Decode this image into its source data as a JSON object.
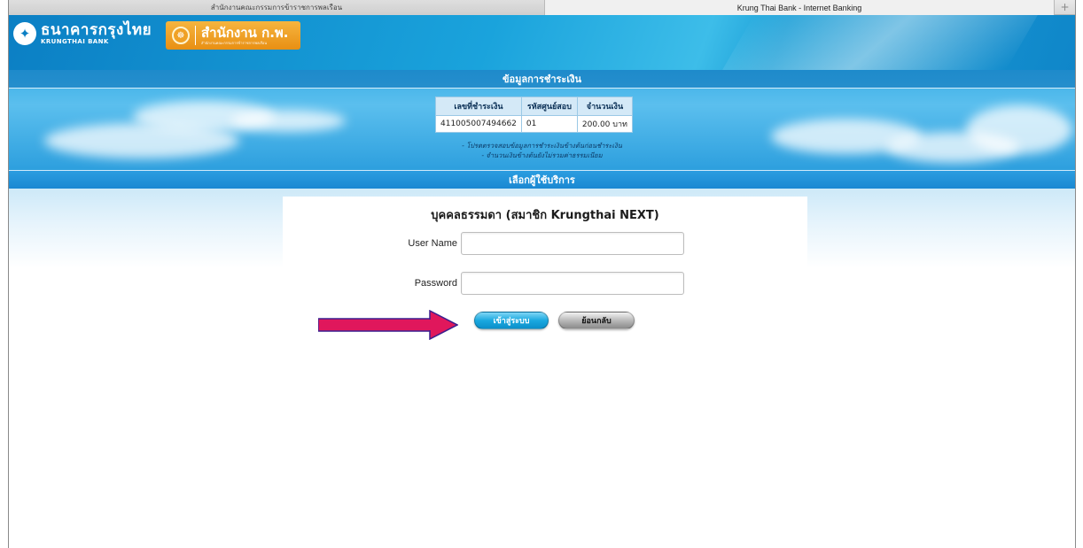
{
  "browser": {
    "tab_inactive": "สำนักงานคณะกรรมการข้าราชการพลเรือน",
    "tab_active": "Krung Thai Bank - Internet Banking",
    "new_tab_glyph": "+"
  },
  "header": {
    "bank_name_th": "ธนาคารกรุงไทย",
    "bank_name_en": "KRUNGTHAI BANK",
    "partner_name": "สำนักงาน ก.พ.",
    "partner_subtitle": "สำนักงานคณะกรรมการข้าราชการพลเรือน"
  },
  "payment": {
    "section_title": "ข้อมูลการชำระเงิน",
    "headers": [
      "เลขที่ชำระเงิน",
      "รหัสศูนย์สอบ",
      "จำนวนเงิน"
    ],
    "row": [
      "411005007494662",
      "01",
      "200.00 บาท"
    ],
    "notes": [
      "- โปรดตรวจสอบข้อมูลการชำระเงินข้างต้นก่อนชำระเงิน",
      "- จำนวนเงินข้างต้นยังไม่รวมค่าธรรมเนียม"
    ]
  },
  "service_bar": "เลือกผู้ใช้บริการ",
  "login": {
    "title": "บุคคลธรรมดา (สมาชิก Krungthai NEXT)",
    "username_label": "User Name",
    "username_value": "",
    "password_label": "Password",
    "password_value": "",
    "login_button": "เข้าสู่ระบบ",
    "back_button": "ย้อนกลับ"
  },
  "colors": {
    "header_blue": "#0b7fc4",
    "sky_blue": "#3aaee6",
    "ocsc_orange": "#f0a125",
    "arrow_pink": "#e0175c"
  },
  "icons": {
    "bank_logo": "krungthai-bird-icon",
    "partner_logo": "ocsc-seal-icon",
    "annotation": "right-arrow-icon"
  }
}
